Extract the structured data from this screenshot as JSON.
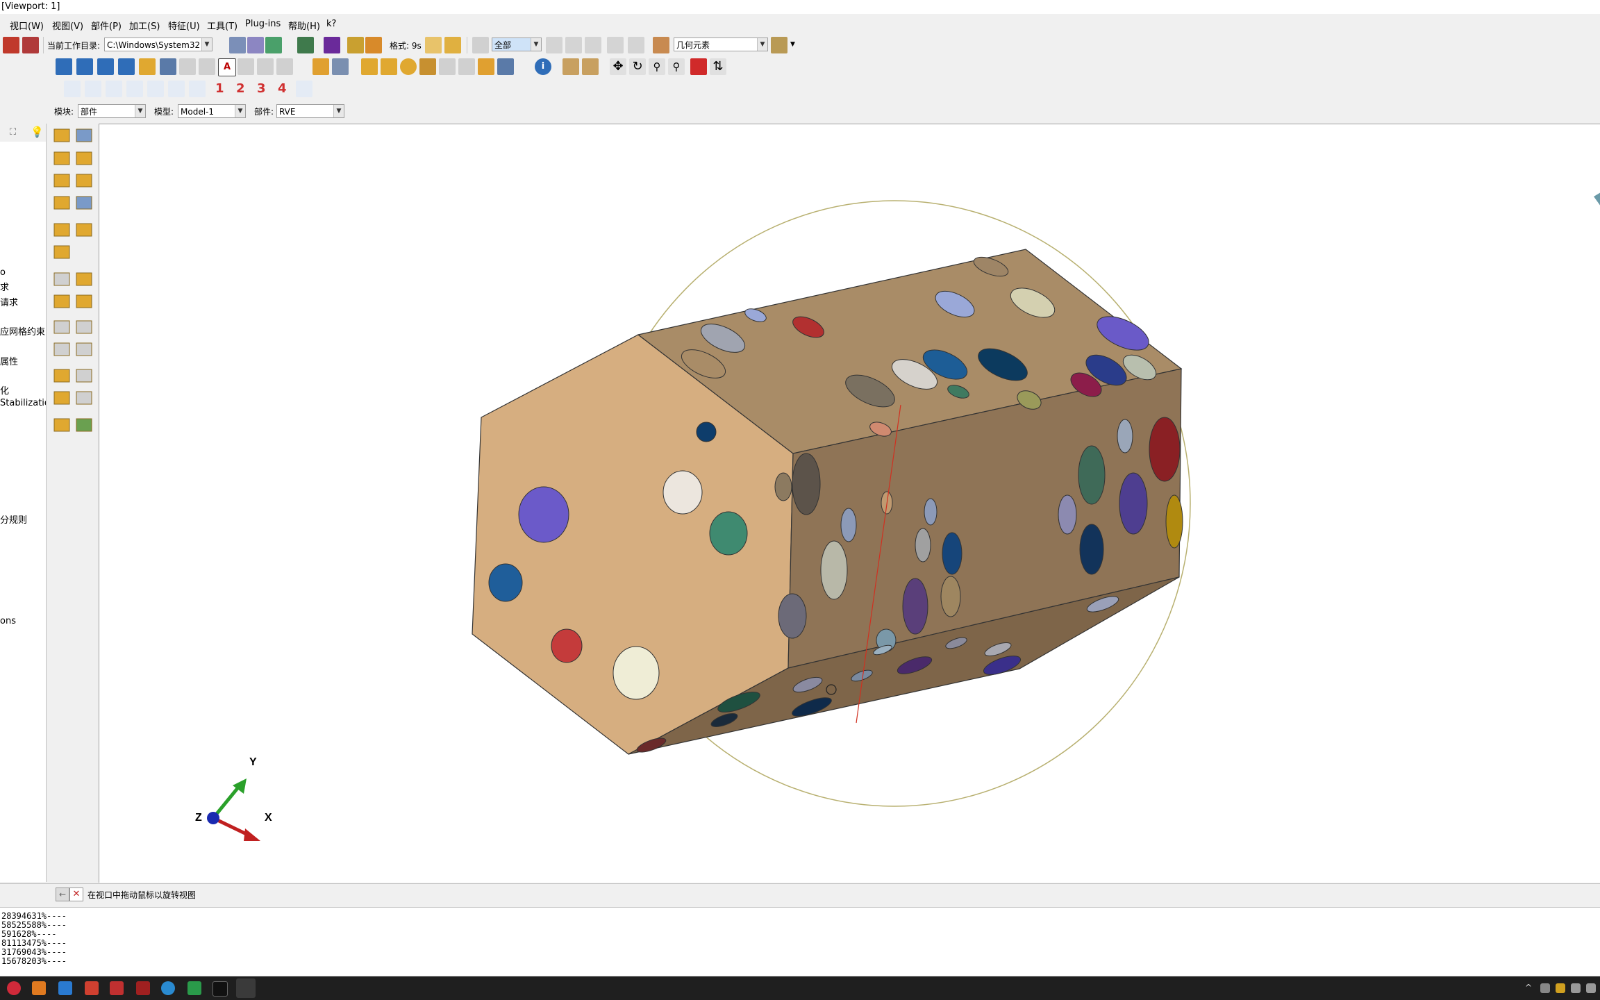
{
  "window": {
    "title": "[Viewport: 1]"
  },
  "menu": [
    "视口(W)",
    "视图(V)",
    "部件(P)",
    "加工(S)",
    "特征(U)",
    "工具(T)",
    "Plug-ins",
    "帮助(H)",
    "k?"
  ],
  "toolbar": {
    "workdir_label": "当前工作目录:",
    "workdir_value": "C:\\Windows\\System32",
    "format_label": "格式: 9s",
    "select_filter": "全部",
    "geometry_filter": "几何元素",
    "view_numbers": [
      "1",
      "2",
      "3",
      "4"
    ]
  },
  "context": {
    "module_label": "模块:",
    "module_value": "部件",
    "model_label": "模型:",
    "model_value": "Model-1",
    "part_label": "部件:",
    "part_value": "RVE"
  },
  "tree": {
    "items": [
      "o",
      "求",
      "请求",
      "应网格约束",
      "属性",
      "化",
      "Stabilization",
      "分规则",
      "ons"
    ]
  },
  "viewport": {
    "triad": {
      "x": "X",
      "y": "Y",
      "z": "Z"
    }
  },
  "prompt": {
    "text": "在视口中拖动鼠标以旋转视图"
  },
  "messages": [
    "28394631%----",
    "58525588%----",
    "591628%----",
    "81113475%----",
    "31769043%----",
    "15678203%----"
  ],
  "colors": {
    "face_front": "#d6ae80",
    "face_top": "#a98c67",
    "face_side": "#8f7456",
    "face_bottom": "#7e6549",
    "rotation_circle": "#b8b070",
    "axis_line": "#d03020",
    "taskbar": "#1f1f1f"
  }
}
